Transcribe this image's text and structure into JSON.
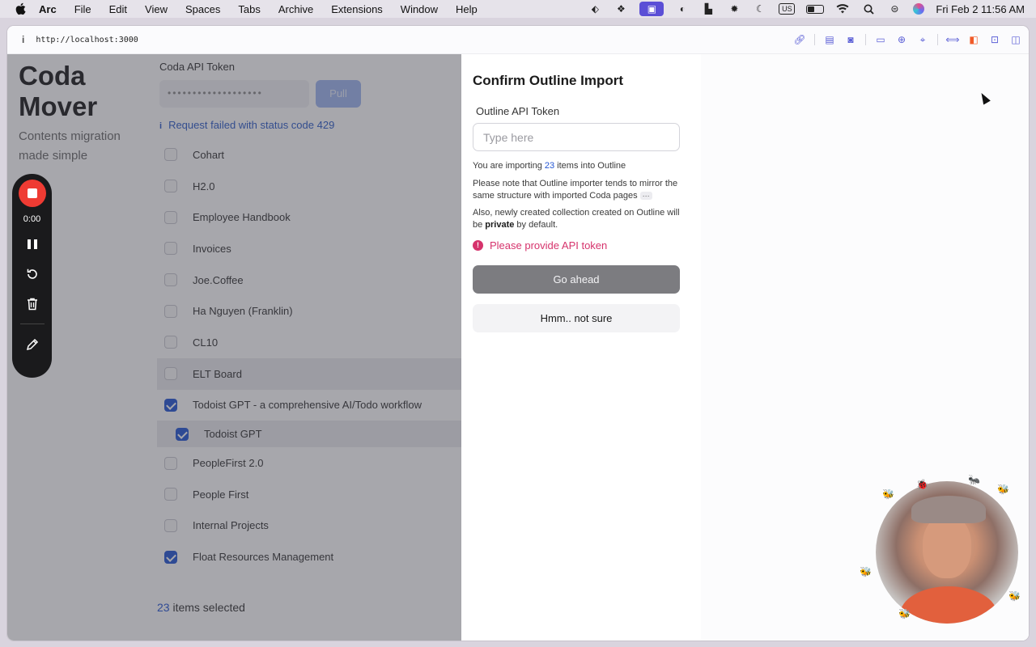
{
  "menubar": {
    "app": "Arc",
    "items": [
      "File",
      "Edit",
      "View",
      "Spaces",
      "Tabs",
      "Archive",
      "Extensions",
      "Window",
      "Help"
    ],
    "keyboard_layout": "US",
    "clock": "Fri Feb 2  11:56 AM"
  },
  "browser": {
    "url": "http://localhost:3000"
  },
  "app": {
    "title": "Coda Mover",
    "subtitle": "Contents migration made simple",
    "token_label": "Coda API Token",
    "token_value": "•••••••••••••••••••",
    "pull_label": "Pull",
    "error_message": "Request failed with status code 429",
    "items": [
      {
        "label": "Cohart",
        "checked": false
      },
      {
        "label": "H2.0",
        "checked": false
      },
      {
        "label": "Employee Handbook",
        "checked": false
      },
      {
        "label": "Invoices",
        "checked": false
      },
      {
        "label": "Joe.Coffee",
        "checked": false
      },
      {
        "label": "Ha Nguyen (Franklin)",
        "checked": false
      },
      {
        "label": "CL10",
        "checked": false
      },
      {
        "label": "ELT Board",
        "checked": false
      },
      {
        "label": "Todoist GPT - a comprehensive AI/Todo workflow",
        "checked": true
      },
      {
        "label": "Todoist GPT",
        "checked": true
      },
      {
        "label": "PeopleFirst 2.0",
        "checked": false
      },
      {
        "label": "People First",
        "checked": false
      },
      {
        "label": "Internal Projects",
        "checked": false
      },
      {
        "label": "Float Resources Management",
        "checked": true
      }
    ],
    "selected_count": "23",
    "selected_suffix": " items selected"
  },
  "recorder": {
    "time": "0:00"
  },
  "modal": {
    "title": "Confirm Outline Import",
    "token_label": "Outline API Token",
    "token_placeholder": "Type here",
    "importing_prefix": "You are importing ",
    "importing_count": "23",
    "importing_suffix": " items into Outline",
    "note": "Please note that Outline importer tends to mirror the same structure with imported Coda pages",
    "note_more": "···",
    "private_prefix": "Also, newly created collection created on Outline will be ",
    "private_word": "private",
    "private_suffix": " by default.",
    "error": "Please provide API token",
    "error_icon": "!",
    "confirm_label": "Go ahead",
    "cancel_label": "Hmm.. not sure"
  },
  "colors": {
    "accent": "#2456d3",
    "error": "#d6336c",
    "record": "#ef3b33"
  }
}
